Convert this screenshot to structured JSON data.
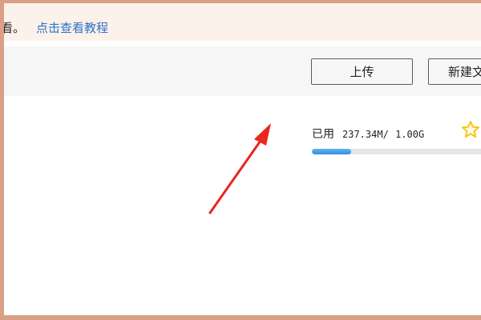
{
  "notice": {
    "text": "看。",
    "link": "点击查看教程"
  },
  "toolbar": {
    "upload_label": "上传",
    "new_folder_label": "新建文"
  },
  "storage": {
    "used_label": "已用",
    "used_amount": "237.34M/",
    "total_amount": "1.00G",
    "used_fraction": 0.2318
  },
  "icons": {
    "star": "star-icon",
    "arrow": "red-pointer-arrow"
  },
  "colors": {
    "link": "#2a72c6",
    "progress": "#3a9ae8",
    "star": "#f5c518",
    "arrow": "#e8271f"
  }
}
